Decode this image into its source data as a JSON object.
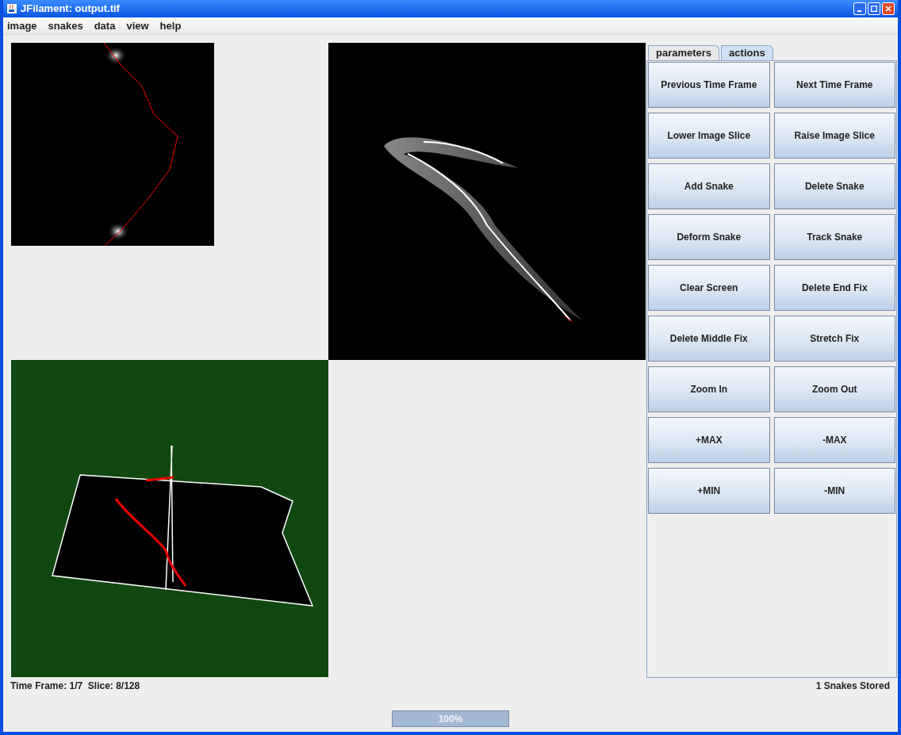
{
  "window": {
    "title": "JFilament: output.tif"
  },
  "menu": [
    "image",
    "snakes",
    "data",
    "view",
    "help"
  ],
  "tabs": [
    {
      "label": "parameters",
      "selected": false
    },
    {
      "label": "actions",
      "selected": true
    }
  ],
  "buttons": [
    "Previous Time Frame",
    "Next Time Frame",
    "Lower Image Slice",
    "Raise Image Slice",
    "Add Snake",
    "Delete Snake",
    "Deform Snake",
    "Track Snake",
    "Clear Screen",
    "Delete End Fix",
    "Delete Middle Fix",
    "Stretch Fix",
    "Zoom In",
    "Zoom Out",
    "+MAX",
    "-MAX",
    "+MIN",
    "-MIN"
  ],
  "status": {
    "left": "Time Frame: 1/7  Slice: 8/128",
    "right": "1 Snakes Stored"
  },
  "progress": {
    "level": 1,
    "label": "100%"
  }
}
